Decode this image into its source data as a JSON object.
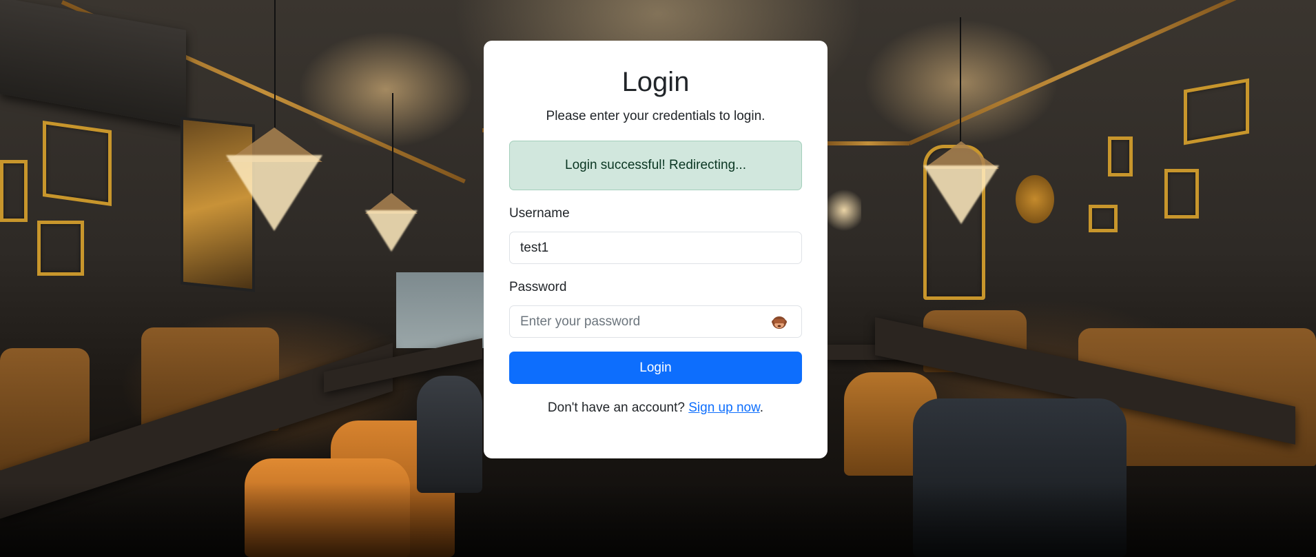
{
  "login": {
    "title": "Login",
    "subtitle": "Please enter your credentials to login.",
    "alert": "Login successful! Redirecting...",
    "username_label": "Username",
    "username_value": "test1",
    "password_label": "Password",
    "password_placeholder": "Enter your password",
    "password_toggle_icon": "see-no-evil-monkey-icon",
    "submit_label": "Login",
    "signup_prompt": "Don't have an account?",
    "signup_link": "Sign up now",
    "signup_suffix": "."
  },
  "colors": {
    "primary": "#0d6efd",
    "alert_bg": "#d1e7dd",
    "alert_text": "#0a3622",
    "card_bg": "#ffffff"
  },
  "background": {
    "icon": "restaurant-interior-photo"
  }
}
